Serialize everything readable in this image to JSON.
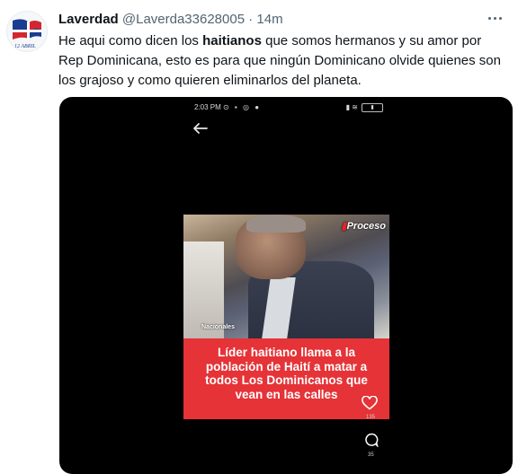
{
  "tweet": {
    "author_name": "Laverdad",
    "handle": "@Laverda33628005",
    "separator": "·",
    "time": "14m",
    "avatar_text": "12 ABRIL",
    "text_before": "He aqui como dicen los ",
    "text_bold": "haitianos",
    "text_after": " que somos hermanos y su amor por Rep Dominicana, esto es para que ningún Dominicano olvide quienes son los grajoso y como quieren eliminarlos del planeta."
  },
  "video": {
    "status_time": "2:03 PM",
    "logo_text": "Proceso",
    "section_tag": "Nacionales",
    "headline": "Líder haitiano llama a la población de Haití a matar a todos Los Dominicanos que vean en las calles",
    "likes_count": "135",
    "comments_count": "35"
  },
  "colors": {
    "banner_red": "#e53337",
    "text_primary": "#0f1419",
    "text_secondary": "#536471"
  },
  "icons": [
    "more-options-icon",
    "back-arrow-icon",
    "heart-icon",
    "comment-icon",
    "battery-icon",
    "signal-icon"
  ]
}
